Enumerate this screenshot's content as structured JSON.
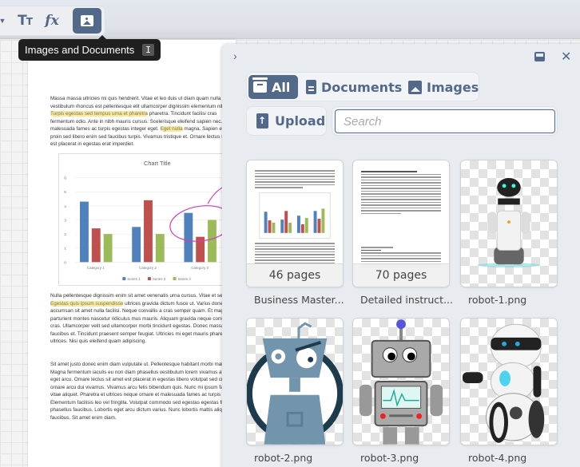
{
  "toolbar": {
    "tools": [
      {
        "name": "dropdown",
        "icon": "caret-down-icon"
      },
      {
        "name": "text",
        "icon": "text-size-icon",
        "label": "Tт"
      },
      {
        "name": "formula",
        "icon": "fx-icon",
        "label": "fx"
      },
      {
        "name": "images-and-documents",
        "icon": "image-icon",
        "active": true
      }
    ],
    "tooltip": {
      "label": "Images and Documents",
      "shortcut": "I"
    }
  },
  "document": {
    "paragraphs": [
      {
        "before": "Massa massa ultricies mi quis hendrerit. Vitae et leo duis ut diam quam nulla dictumst vestibulum rhoncus est pellentesque elit ullamcorper dignissim elementum nibh. ",
        "highlight": "Turpis egestas sed tempus urna et pharetra",
        "after": " pharetra. Tincidunt facilisi cras fermentum odio. Ante in nibh mauris cursus. Scelerisque eleifend sapien nec. Et malesuada fames ac turpis egestas integer eget. ",
        "highlight2": "Eget nulla",
        "after2": " magna. Sapien eget mi proin sed libero enim sed faucibus turpis. Vivamus tristique et. Ornare lectus sit amet est placerat in egestas erat imperdiet."
      },
      {
        "before": "Nulla pellentesque dignissim enim sit amet venenatis urna cursus. Vitae et sed. ",
        "highlight": "Egestas quis ipsum suspendisse",
        "after": " ultrices gravida dictum fusce ut. Varius donec. Dui accumsan sit amet nulla facilisi. Neque convallis a cras semper quam. Et magnis dis parturient montes nascetur ridiculus mus mauris. Aliquam gravida neque convallis a cras. Ullamcorper velit sed ullamcorper morbi tincidunt egestas. Donec massa sapien faucibus et. Tincidunt praesent semper feugiat. Ultricies mi eget mauris pharetra et ultrices. Nisi quis eleifend quam adipiscing."
      },
      {
        "before": "Sit amet justo donec enim diam vulputate ut. Pellentesque habitant morbi malesuada. Magna fermentum iaculis eu non diam phasellus vestibulum lorem vivamus at augue eget arcu. Ornare lectus sit amet est placerat in egestas libero volutpat sed cras ornare arcu dui vivamus. Vivamus arcu felis bibendum quis. Nunc mi ipsum faucibus vitae aliquet. Pharetra et ultrices neque ornare et malesuada fames ac turpis egestas. Elementum facilisis leo vel fringilla. Volutpat commodo sed egestas egestas fringilla phasellus faucibus. Lobortis eget arcu dictum varius. Nunc lobortis mattis aliquam faucibus. Sit amet enim diam."
      }
    ]
  },
  "chart_data": {
    "type": "bar",
    "title": "Chart Title",
    "categories": [
      "Category 1",
      "Category 2",
      "Category 3"
    ],
    "series": [
      {
        "name": "Series 1",
        "values": [
          4.3,
          2.5,
          3.5
        ],
        "color": "#4f81bd"
      },
      {
        "name": "Series 2",
        "values": [
          2.4,
          4.4,
          1.8
        ],
        "color": "#c0504d"
      },
      {
        "name": "Series 3",
        "values": [
          2.0,
          2.0,
          3.0
        ],
        "color": "#9bbb59"
      }
    ],
    "ylim": [
      0,
      6
    ],
    "yticks": [
      "0",
      "1",
      "2",
      "3",
      "4",
      "5",
      "6"
    ],
    "legend": "bottom",
    "grid": true,
    "annotation": "pink hand-drawn circle around Category 3"
  },
  "panel": {
    "collapse_icon": "chevron-right-icon",
    "dock_icon": "dock-bottom-icon",
    "close_icon": "close-icon",
    "filters": [
      {
        "label": "All",
        "icon": "archive-icon",
        "active": true
      },
      {
        "label": "Documents",
        "icon": "document-icon",
        "active": false
      },
      {
        "label": "Images",
        "icon": "image-icon",
        "active": false
      }
    ],
    "upload_label": "Upload",
    "search_placeholder": "Search",
    "search_value": "",
    "items": [
      {
        "kind": "document",
        "pages": "46 pages",
        "name": "Business Master..."
      },
      {
        "kind": "document",
        "pages": "70 pages",
        "name": "Detailed instruct..."
      },
      {
        "kind": "image",
        "name": "robot-1.png"
      },
      {
        "kind": "image",
        "name": "robot-2.png"
      },
      {
        "kind": "image",
        "name": "robot-3.png"
      },
      {
        "kind": "image",
        "name": "robot-4.png"
      }
    ]
  },
  "colors": {
    "accent": "#52698a",
    "highlight": "#fbe99a",
    "tooltip_bg": "#1f1f1f"
  }
}
